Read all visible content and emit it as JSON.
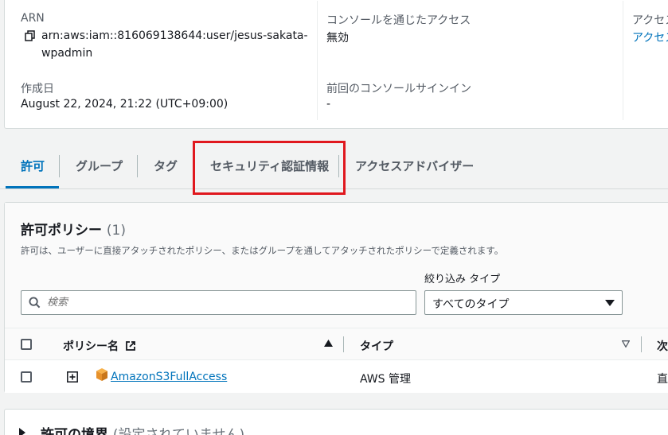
{
  "summary": {
    "arn_label": "ARN",
    "arn_line1": "arn:aws:iam::816069138644:user/jesus-sakata-",
    "arn_line2": "wpadmin",
    "created_label": "作成日",
    "created_value": "August 22, 2024, 21:22 (UTC+09:00)",
    "console_access_label": "コンソールを通じたアクセス",
    "console_access_value": "無効",
    "last_signin_label": "前回のコンソールサインイン",
    "last_signin_value": "-",
    "access_key_label": "アクセス",
    "access_key_link": "アクセス"
  },
  "tabs": [
    {
      "label": "許可",
      "active": true
    },
    {
      "label": "グループ",
      "active": false
    },
    {
      "label": "タグ",
      "active": false
    },
    {
      "label": "セキュリティ認証情報",
      "active": false
    },
    {
      "label": "アクセスアドバイザー",
      "active": false
    }
  ],
  "policies": {
    "title": "許可ポリシー",
    "count": "(1)",
    "description": "許可は、ユーザーに直接アタッチされたポリシー、またはグループを通してアタッチされたポリシーで定義されます。",
    "search_placeholder": "検索",
    "filter_label": "絞り込み タイプ",
    "filter_value": "すべてのタイプ",
    "columns": {
      "name": "ポリシー名",
      "type": "タイプ",
      "next": "次"
    },
    "rows": [
      {
        "name": "AmazonS3FullAccess",
        "type": "AWS 管理",
        "next": "直"
      }
    ]
  },
  "boundary": {
    "title": "許可の境界",
    "subtitle": "(設定されていません)"
  },
  "colors": {
    "accent": "#0073bb",
    "highlight": "#e0181e",
    "s3_orange": "#e7912b"
  }
}
